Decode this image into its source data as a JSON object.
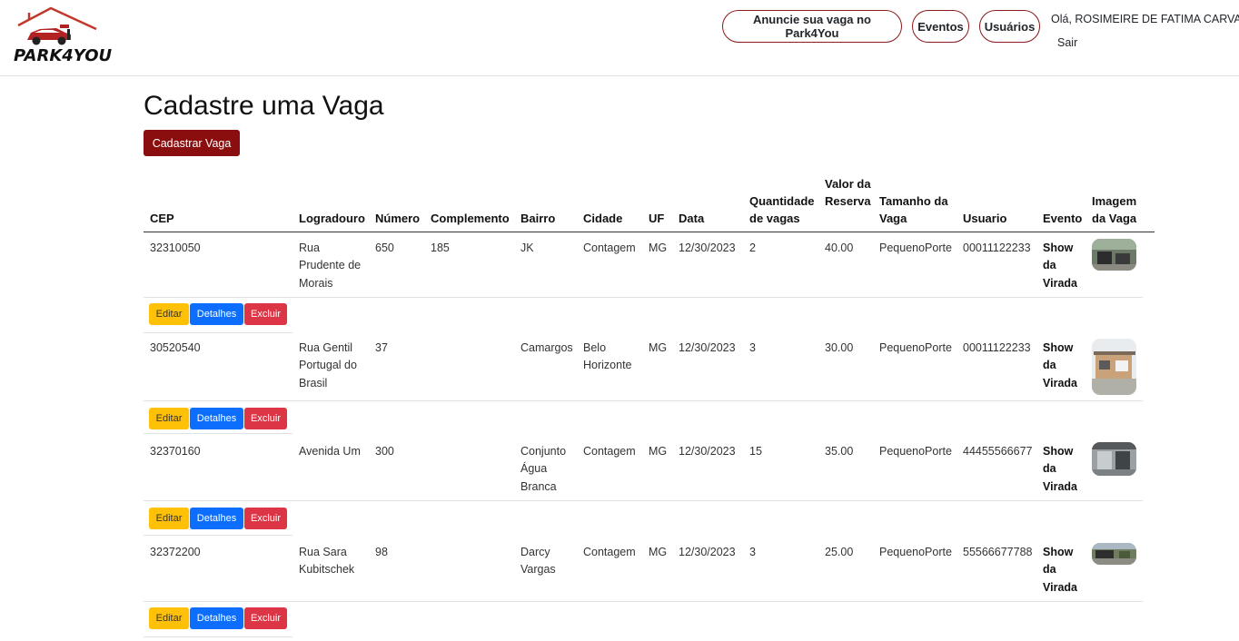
{
  "brand": {
    "name": "PARK4YOU"
  },
  "nav": {
    "anuncie": "Anuncie sua vaga no Park4You",
    "eventos": "Eventos",
    "usuarios": "Usuários",
    "greeting": "Olá, ROSIMEIRE DE FATIMA CARVALHO",
    "logout": "Sair"
  },
  "page": {
    "title": "Cadastre uma Vaga",
    "cadastrar": "Cadastrar Vaga"
  },
  "table": {
    "headers": {
      "cep": "CEP",
      "logradouro": "Logradouro",
      "numero": "Número",
      "complemento": "Complemento",
      "bairro": "Bairro",
      "cidade": "Cidade",
      "uf": "UF",
      "data": "Data",
      "quantidade": "Quantidade de vagas",
      "valor": "Valor da Reserva",
      "tamanho": "Tamanho da Vaga",
      "usuario": "Usuario",
      "evento": "Evento",
      "imagem": "Imagem da Vaga"
    },
    "rows": [
      {
        "cep": "32310050",
        "logradouro": "Rua Prudente de Morais",
        "numero": "650",
        "complemento": "185",
        "bairro": "JK",
        "cidade": "Contagem",
        "uf": "MG",
        "data": "12/30/2023",
        "quantidade": "2",
        "valor": "40.00",
        "tamanho": "PequenoPorte",
        "usuario": "00011122233",
        "evento": "Show da Virada"
      },
      {
        "cep": "30520540",
        "logradouro": "Rua Gentil Portugal do Brasil",
        "numero": "37",
        "complemento": "",
        "bairro": "Camargos",
        "cidade": "Belo Horizonte",
        "uf": "MG",
        "data": "12/30/2023",
        "quantidade": "3",
        "valor": "30.00",
        "tamanho": "PequenoPorte",
        "usuario": "00011122233",
        "evento": "Show da Virada"
      },
      {
        "cep": "32370160",
        "logradouro": "Avenida Um",
        "numero": "300",
        "complemento": "",
        "bairro": "Conjunto Água Branca",
        "cidade": "Contagem",
        "uf": "MG",
        "data": "12/30/2023",
        "quantidade": "15",
        "valor": "35.00",
        "tamanho": "PequenoPorte",
        "usuario": "44455566677",
        "evento": "Show da Virada"
      },
      {
        "cep": "32372200",
        "logradouro": "Rua Sara Kubitschek",
        "numero": "98",
        "complemento": "",
        "bairro": "Darcy Vargas",
        "cidade": "Contagem",
        "uf": "MG",
        "data": "12/30/2023",
        "quantidade": "3",
        "valor": "25.00",
        "tamanho": "PequenoPorte",
        "usuario": "55566677788",
        "evento": "Show da Virada"
      }
    ]
  },
  "actions": {
    "edit": "Editar",
    "details": "Detalhes",
    "delete": "Excluir"
  },
  "colors": {
    "brand_red": "#8b0e0e",
    "warning": "#ffc107",
    "primary": "#0d6efd",
    "danger": "#dc3545"
  }
}
